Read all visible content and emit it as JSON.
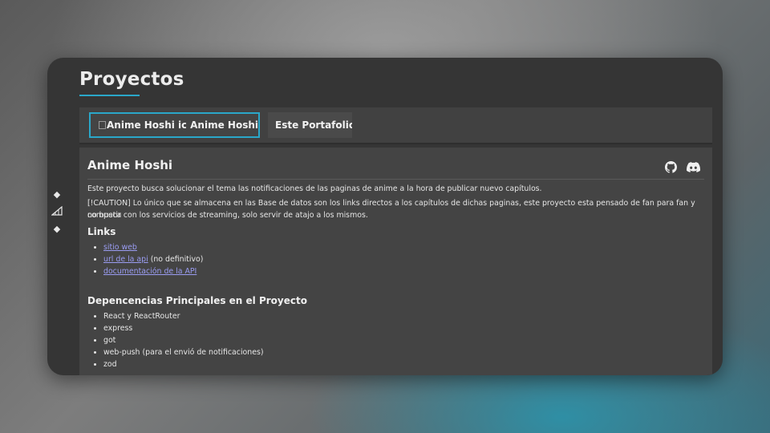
{
  "page": {
    "title": "Proyectos"
  },
  "tabs": [
    {
      "image_alt": "Anime Hoshi icon",
      "label": "Anime Hoshi",
      "active": true
    },
    {
      "label": "Este Portafolio",
      "active": false
    }
  ],
  "side_icons": [
    "dot-icon",
    "signal-icon",
    "dot-icon"
  ],
  "project": {
    "title": "Anime Hoshi",
    "icons": [
      "github-icon",
      "discord-icon"
    ],
    "description": "Este proyecto busca solucionar el tema las notificaciones de las paginas de anime a la hora de publicar nuevo capítulos.",
    "caution_line1": "[!CAUTION] Lo único que se almacena en las Base de datos son los links directos a los capítulos de dichas paginas, este proyecto esta pensado de fan para fan y no busca",
    "caution_line2": "competir con los servicios de streaming, solo servir de atajo a los mismos.",
    "links_heading": "Links",
    "links": [
      {
        "text": "sitio web",
        "suffix": ""
      },
      {
        "text": "url de la api",
        "suffix": " (no definitivo)"
      },
      {
        "text": "documentación de la API",
        "suffix": ""
      }
    ],
    "deps_heading": "Depencencias Principales en el Proyecto",
    "deps": [
      "React y ReactRouter",
      "express",
      "got",
      "web-push (para el envió de notificaciones)",
      "zod"
    ]
  },
  "colors": {
    "accent": "#2aa7c9",
    "window_bg": "#353535",
    "panel_bg": "#444444",
    "link": "#9a9cf2"
  }
}
